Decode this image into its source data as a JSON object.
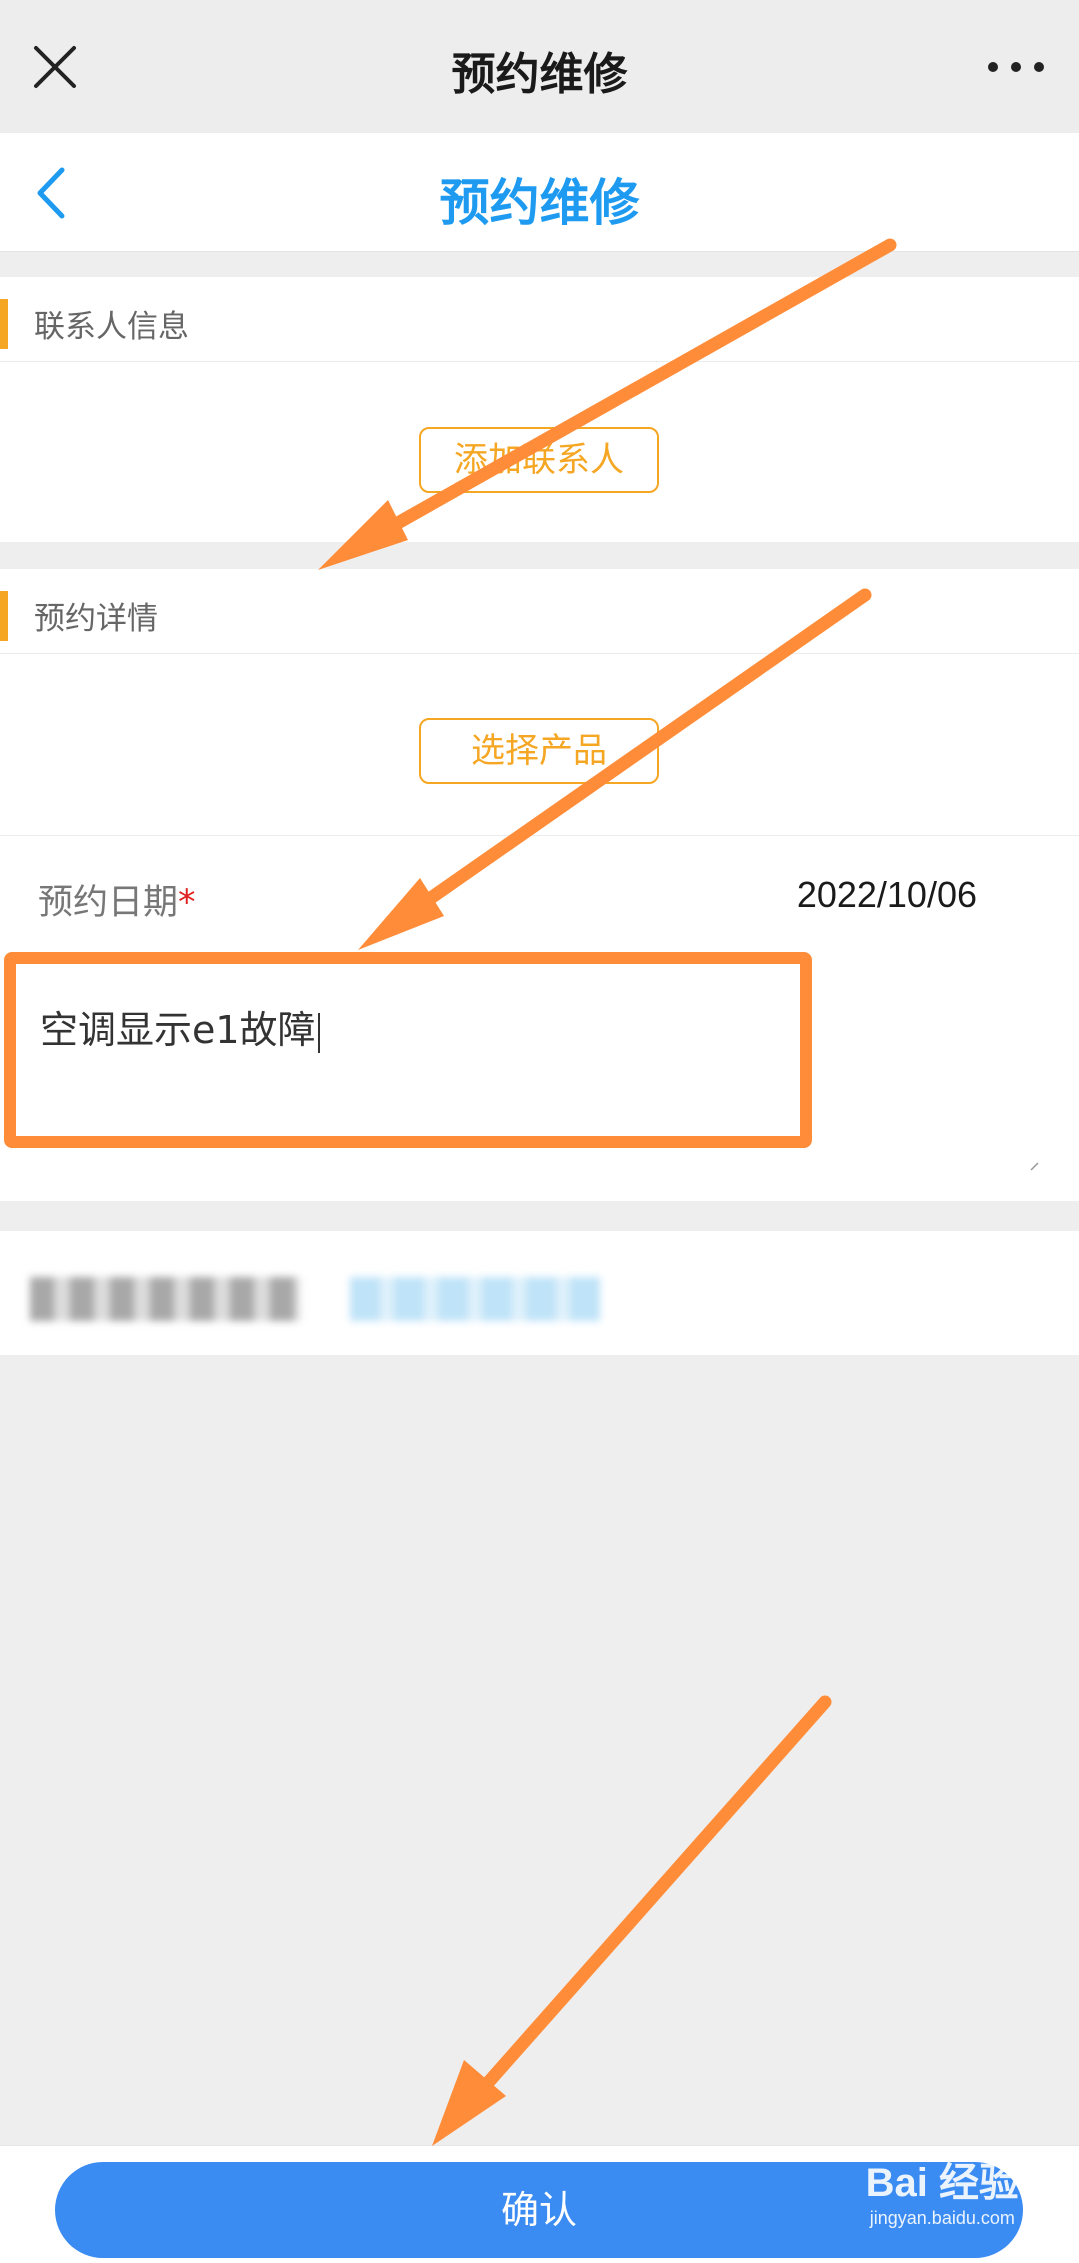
{
  "window": {
    "title": "预约维修"
  },
  "header": {
    "title": "预约维修"
  },
  "contact_section": {
    "label": "联系人信息",
    "add_button": "添加联系人"
  },
  "booking_section": {
    "label": "预约详情",
    "select_product_button": "选择产品",
    "date_label": "预约日期",
    "required_mark": "*",
    "date_value": "2022/10/06",
    "description_value": "空调显示e1故障"
  },
  "footer": {
    "confirm_label": "确认"
  },
  "watermark": {
    "main": "Bai 经验",
    "sub": "jingyan.baidu.com"
  },
  "colors": {
    "accent_blue": "#1e9bf0",
    "button_blue": "#3a8bf2",
    "orange": "#f5a623",
    "annotation_orange": "#ff8c38"
  }
}
